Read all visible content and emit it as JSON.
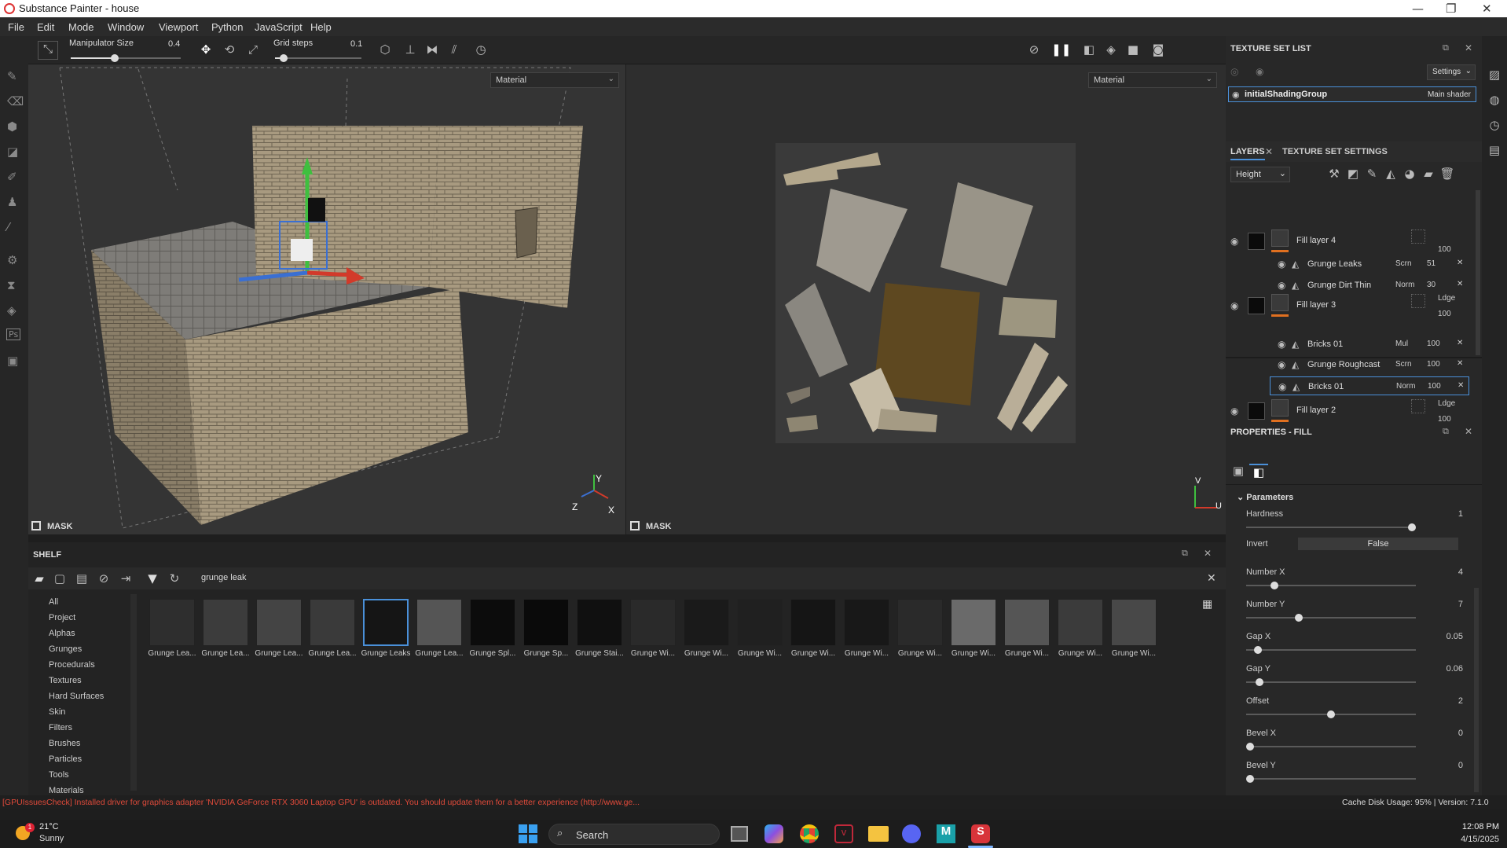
{
  "window": {
    "title": "Substance Painter - house",
    "controls": [
      "—",
      "❐",
      "✕"
    ]
  },
  "menu": [
    "File",
    "Edit",
    "Mode",
    "Window",
    "Viewport",
    "Python",
    "JavaScript",
    "Help"
  ],
  "toolbar": {
    "manip_label": "Manipulator Size",
    "manip_value": "0.4",
    "manip_level": 0.4,
    "grid_label": "Grid steps",
    "grid_value": "0.1",
    "grid_level": 0.1
  },
  "viewport": {
    "left_mode": "Material",
    "right_mode": "Material",
    "mask_label": "MASK",
    "axis_y": "Y",
    "axis_z": "Z",
    "axis_x": "X",
    "uv_v": "V",
    "uv_u": "U"
  },
  "texture_set_list": {
    "title": "TEXTURE SET LIST",
    "settings": "Settings",
    "group": "initialShadingGroup",
    "shader": "Main shader"
  },
  "layers": {
    "tab_layers": "LAYERS",
    "tab_tss": "TEXTURE SET SETTINGS",
    "channel": "Height",
    "rows": [
      {
        "name": "Fill layer 4",
        "blend": "",
        "opacity": "100",
        "kind": "layer"
      },
      {
        "name": "Grunge Leaks",
        "blend": "Scrn",
        "opacity": "51",
        "kind": "effect"
      },
      {
        "name": "Grunge Dirt Thin",
        "blend": "Norm",
        "opacity": "30",
        "kind": "effect"
      },
      {
        "name": "Fill layer 3",
        "blend": "Ldge",
        "opacity": "100",
        "kind": "layer"
      },
      {
        "name": "Bricks 01",
        "blend": "Mul",
        "opacity": "100",
        "kind": "effect"
      },
      {
        "name": "Grunge Roughcast",
        "blend": "Scrn",
        "opacity": "100",
        "kind": "effect"
      },
      {
        "name": "Bricks 01",
        "blend": "Norm",
        "opacity": "100",
        "kind": "effect"
      },
      {
        "name": "Fill layer 2",
        "blend": "Ldge",
        "opacity": "100",
        "kind": "layer"
      }
    ]
  },
  "properties": {
    "title": "PROPERTIES - FILL",
    "section": "Parameters",
    "params": [
      {
        "label": "Hardness",
        "value": "1",
        "level": 1.0
      },
      {
        "label": "Invert",
        "value": "False",
        "level": null
      },
      {
        "label": "Number X",
        "value": "4",
        "level": 0.15
      },
      {
        "label": "Number Y",
        "value": "7",
        "level": 0.3
      },
      {
        "label": "Gap X",
        "value": "0.05",
        "level": 0.05
      },
      {
        "label": "Gap Y",
        "value": "0.06",
        "level": 0.06
      },
      {
        "label": "Offset",
        "value": "2",
        "level": 0.5
      },
      {
        "label": "Bevel X",
        "value": "0",
        "level": 0.0
      },
      {
        "label": "Bevel Y",
        "value": "0",
        "level": 0.0
      }
    ]
  },
  "shelf": {
    "title": "SHELF",
    "search": "grunge leak",
    "categories": [
      "All",
      "Project",
      "Alphas",
      "Grunges",
      "Procedurals",
      "Textures",
      "Hard Surfaces",
      "Skin",
      "Filters",
      "Brushes",
      "Particles",
      "Tools",
      "Materials"
    ],
    "items": [
      "Grunge Lea...",
      "Grunge Lea...",
      "Grunge Lea...",
      "Grunge Lea...",
      "Grunge Leaks",
      "Grunge Lea...",
      "Grunge Spl...",
      "Grunge Sp...",
      "Grunge Stai...",
      "Grunge Wi...",
      "Grunge Wi...",
      "Grunge Wi...",
      "Grunge Wi...",
      "Grunge Wi...",
      "Grunge Wi...",
      "Grunge Wi...",
      "Grunge Wi...",
      "Grunge Wi...",
      "Grunge Wi..."
    ]
  },
  "status": {
    "message": "[GPUIssuesCheck] Installed driver for graphics adapter 'NVIDIA GeForce RTX 3060 Laptop GPU' is outdated. You should update them for a better experience (http://www.ge...",
    "cache": "Cache Disk Usage:   95% | Version: 7.1.0"
  },
  "taskbar": {
    "temp": "21°C",
    "weather": "Sunny",
    "badge": "1",
    "search": "Search",
    "time": "12:08 PM",
    "date": "4/15/2025"
  }
}
